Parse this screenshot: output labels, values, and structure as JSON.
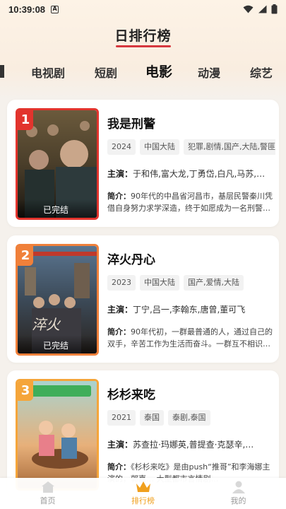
{
  "status_bar": {
    "time": "10:39:08",
    "notification_icon": "A"
  },
  "header": {
    "title": "日排行榜"
  },
  "category_tabs": [
    {
      "label": "电视剧",
      "active": false
    },
    {
      "label": "短剧",
      "active": false
    },
    {
      "label": "电影",
      "active": true
    },
    {
      "label": "动漫",
      "active": false
    },
    {
      "label": "综艺",
      "active": false
    }
  ],
  "list": [
    {
      "rank": "1",
      "title": "我是刑警",
      "status": "已完结",
      "tags": [
        "2024",
        "中国大陆",
        "犯罪,剧情,国产,大陆,警匪,悬疑"
      ],
      "actors_label": "主演：",
      "actors": "于和伟,富大龙,丁勇岱,白凡,马苏,…",
      "intro_label": "简介：",
      "intro": "90年代的中昌省河昌市，基层民警秦川凭借自身努力求学深造，终于如愿成为一名刑警…"
    },
    {
      "rank": "2",
      "title": "淬火丹心",
      "status": "已完结",
      "tags": [
        "2023",
        "中国大陆",
        "国产,爱情,大陆"
      ],
      "actors_label": "主演：",
      "actors": "丁宁,吕一,李翰东,唐曾,董可飞",
      "intro_label": "简介：",
      "intro": "90年代初，一群最普通的人，通过自己的双手，辛苦工作为生活而奋斗。一群互不相识…"
    },
    {
      "rank": "3",
      "title": "杉杉来吃",
      "status": "",
      "tags": [
        "2021",
        "泰国",
        "泰剧,泰国"
      ],
      "actors_label": "主演：",
      "actors": "苏查拉·玛娜英,普提查·克瑟辛,…",
      "intro_label": "简介：",
      "intro": "《杉杉来吃》是由push“推哥”和李海娜主演的，郭嘉… 大型都市言情剧…"
    }
  ],
  "bottom_nav": [
    {
      "label": "首页",
      "icon": "home-icon",
      "active": false
    },
    {
      "label": "排行榜",
      "icon": "crown-icon",
      "active": true
    },
    {
      "label": "我的",
      "icon": "user-icon",
      "active": false
    }
  ],
  "colors": {
    "accent": "#f0a01e",
    "rank1": "#e2342d",
    "rank2": "#f0803a",
    "rank3": "#f5a53a",
    "tab_highlight": "#f5c542"
  }
}
